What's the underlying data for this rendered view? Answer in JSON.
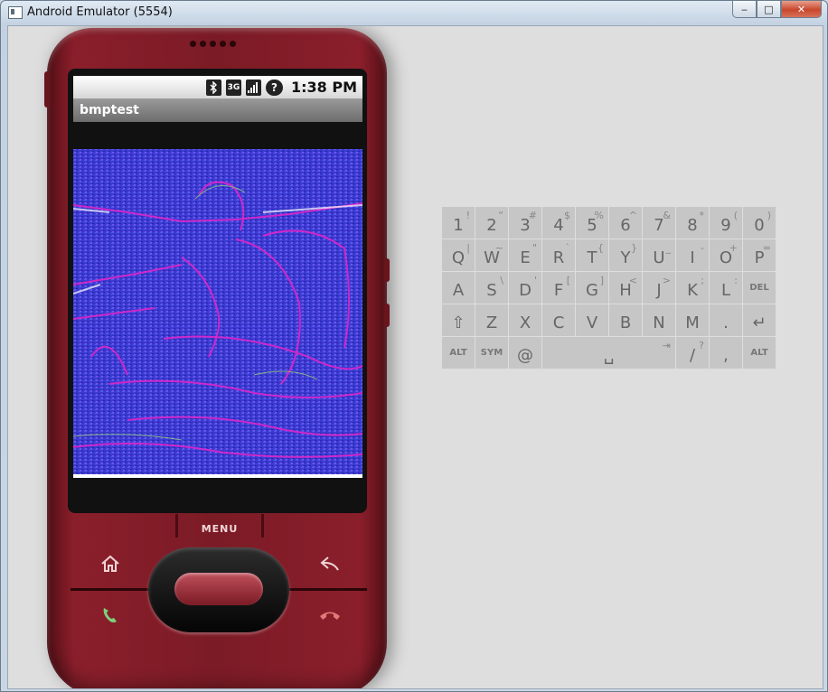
{
  "window": {
    "title": "Android Emulator (5554)",
    "controls": {
      "minimize": "‒",
      "maximize": "□",
      "close": "✕"
    }
  },
  "phone": {
    "status_bar": {
      "icons": [
        "bluetooth-icon",
        "3g-icon",
        "signal-icon",
        "alert-icon"
      ],
      "net_label": "3G",
      "alert_label": "?",
      "time": "1:38 PM"
    },
    "app_title": "bmptest",
    "menu_label": "MENU",
    "buttons": [
      "home-icon",
      "back-icon",
      "call-icon",
      "end-call-icon"
    ],
    "colors": {
      "body": "#7b1b26",
      "screen_bitmap_primary": "#3b3bd6",
      "screen_bitmap_accent": "#e020c8"
    }
  },
  "keyboard": {
    "rows": [
      [
        {
          "main": "1",
          "sub": "!"
        },
        {
          "main": "2",
          "sub": "“"
        },
        {
          "main": "3",
          "sub": "#"
        },
        {
          "main": "4",
          "sub": "$"
        },
        {
          "main": "5",
          "sub": "%"
        },
        {
          "main": "6",
          "sub": "^"
        },
        {
          "main": "7",
          "sub": "&"
        },
        {
          "main": "8",
          "sub": "*"
        },
        {
          "main": "9",
          "sub": "("
        },
        {
          "main": "0",
          "sub": ")"
        }
      ],
      [
        {
          "main": "Q",
          "sub": "|"
        },
        {
          "main": "W",
          "sub": "~"
        },
        {
          "main": "E",
          "sub": "\""
        },
        {
          "main": "R",
          "sub": "`"
        },
        {
          "main": "T",
          "sub": "{"
        },
        {
          "main": "Y",
          "sub": "}"
        },
        {
          "main": "U",
          "sub": "_"
        },
        {
          "main": "I",
          "sub": "-"
        },
        {
          "main": "O",
          "sub": "+"
        },
        {
          "main": "P",
          "sub": "="
        }
      ],
      [
        {
          "main": "A",
          "sub": ""
        },
        {
          "main": "S",
          "sub": "\\"
        },
        {
          "main": "D",
          "sub": "'"
        },
        {
          "main": "F",
          "sub": "["
        },
        {
          "main": "G",
          "sub": "]"
        },
        {
          "main": "H",
          "sub": "<"
        },
        {
          "main": "J",
          "sub": ">"
        },
        {
          "main": "K",
          "sub": ";"
        },
        {
          "main": "L",
          "sub": ":"
        },
        {
          "main": "DEL",
          "sub": "",
          "small": true
        }
      ],
      [
        {
          "main": "⇧",
          "sub": ""
        },
        {
          "main": "Z",
          "sub": ""
        },
        {
          "main": "X",
          "sub": ""
        },
        {
          "main": "C",
          "sub": ""
        },
        {
          "main": "V",
          "sub": ""
        },
        {
          "main": "B",
          "sub": ""
        },
        {
          "main": "N",
          "sub": ""
        },
        {
          "main": "M",
          "sub": ""
        },
        {
          "main": ".",
          "sub": ""
        },
        {
          "main": "↵",
          "sub": ""
        }
      ],
      [
        {
          "main": "ALT",
          "sub": "",
          "small": true
        },
        {
          "main": "SYM",
          "sub": "",
          "small": true
        },
        {
          "main": "@",
          "sub": ""
        },
        {
          "main": "␣",
          "sub": "⇥",
          "space": true
        },
        {
          "main": "/",
          "sub": "?"
        },
        {
          "main": ",",
          "sub": ""
        },
        {
          "main": "ALT",
          "sub": "",
          "small": true
        }
      ]
    ]
  }
}
